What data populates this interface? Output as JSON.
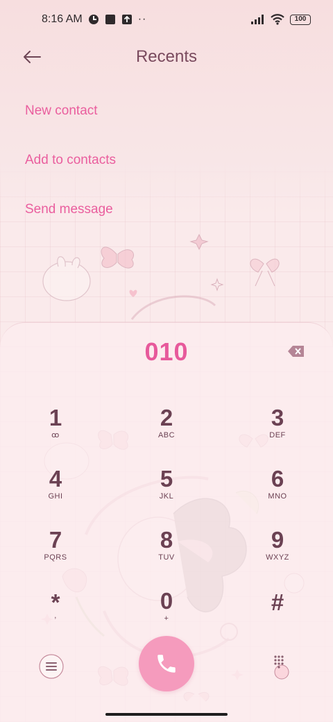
{
  "status_bar": {
    "time": "8:16 AM",
    "icons": [
      "app-icon-a",
      "square-icon",
      "upload-icon",
      "more-dots-icon"
    ],
    "right_icons": [
      "signal-icon",
      "wifi-icon"
    ],
    "battery": "100"
  },
  "header": {
    "title": "Recents",
    "back_icon": "back-arrow-icon"
  },
  "options": {
    "new_contact": "New contact",
    "add_to_contacts": "Add to contacts",
    "send_message": "Send message"
  },
  "dialer": {
    "number": "010",
    "keys": [
      {
        "digit": "1",
        "letters": "ꝏ"
      },
      {
        "digit": "2",
        "letters": "ABC"
      },
      {
        "digit": "3",
        "letters": "DEF"
      },
      {
        "digit": "4",
        "letters": "GHI"
      },
      {
        "digit": "5",
        "letters": "JKL"
      },
      {
        "digit": "6",
        "letters": "MNO"
      },
      {
        "digit": "7",
        "letters": "PQRS"
      },
      {
        "digit": "8",
        "letters": "TUV"
      },
      {
        "digit": "9",
        "letters": "WXYZ"
      },
      {
        "digit": "*",
        "letters": ","
      },
      {
        "digit": "0",
        "letters": "+"
      },
      {
        "digit": "#",
        "letters": ""
      }
    ]
  },
  "colors": {
    "accent": "#ea5e9e",
    "call_button": "#f59bbd",
    "key_text": "#6b4153",
    "title_text": "#7a4a5e"
  }
}
